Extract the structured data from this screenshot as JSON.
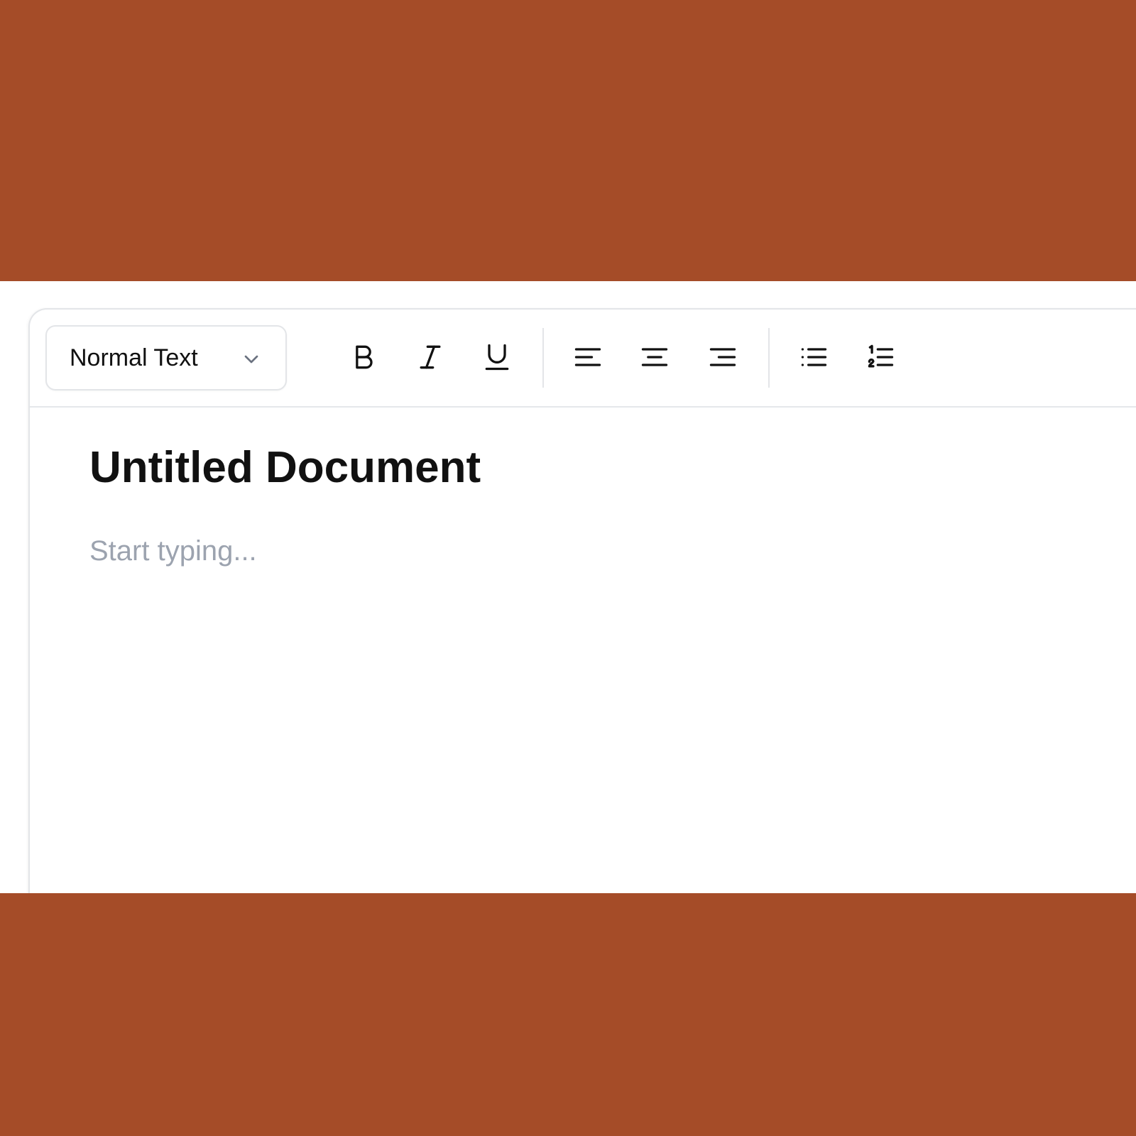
{
  "toolbar": {
    "text_style": {
      "selected": "Normal Text",
      "icon": "chevron-down-icon"
    },
    "buttons": [
      {
        "name": "bold",
        "icon": "bold-icon"
      },
      {
        "name": "italic",
        "icon": "italic-icon"
      },
      {
        "name": "underline",
        "icon": "underline-icon"
      },
      {
        "name": "align-left",
        "icon": "align-left-icon"
      },
      {
        "name": "align-center",
        "icon": "align-center-icon"
      },
      {
        "name": "align-right",
        "icon": "align-right-icon"
      },
      {
        "name": "bullet-list",
        "icon": "bullet-list-icon"
      },
      {
        "name": "numbered-list",
        "icon": "numbered-list-icon"
      }
    ]
  },
  "document": {
    "title": "Untitled Document",
    "body_placeholder": "Start typing..."
  },
  "colors": {
    "background": "#a54c28",
    "surface": "#ffffff",
    "border": "#e3e5e8",
    "text": "#111111",
    "placeholder": "#9ca3af"
  }
}
